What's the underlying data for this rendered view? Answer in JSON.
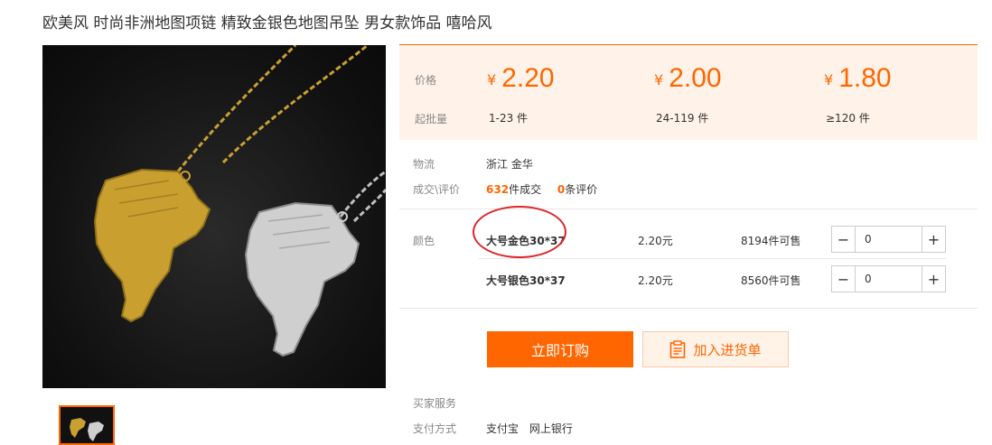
{
  "product": {
    "title": "欧美风 时尚非洲地图项链 精致金银色地图吊坠 男女款饰品 嘻哈风"
  },
  "price_panel": {
    "price_label": "价格",
    "moq_label": "起批量",
    "currency": "¥",
    "tiers": [
      {
        "price": "2.20",
        "range": "1-23 件"
      },
      {
        "price": "2.00",
        "range": "24-119 件"
      },
      {
        "price": "1.80",
        "range": "≥120 件"
      }
    ]
  },
  "logistics": {
    "label": "物流",
    "value": "浙江 金华"
  },
  "sales": {
    "label": "成交\\评价",
    "deals_count": "632",
    "deals_suffix": "件成交",
    "reviews_count": "0",
    "reviews_suffix": "条评价"
  },
  "sku": {
    "label": "颜色",
    "items": [
      {
        "name": "大号金色30*37",
        "price": "2.20元",
        "stock": "8194件可售",
        "quantity": "0"
      },
      {
        "name": "大号银色30*37",
        "price": "2.20元",
        "stock": "8560件可售",
        "quantity": "0"
      }
    ]
  },
  "actions": {
    "buy_label": "立即订购",
    "cart_label": "加入进货单"
  },
  "services": {
    "buyer_service_label": "买家服务",
    "payment_label": "支付方式",
    "payment_methods": [
      "支付宝",
      "网上银行"
    ]
  },
  "colors": {
    "accent": "#ff6600",
    "price_bg": "#fff2e8",
    "annotation_circle": "#e0242a"
  }
}
